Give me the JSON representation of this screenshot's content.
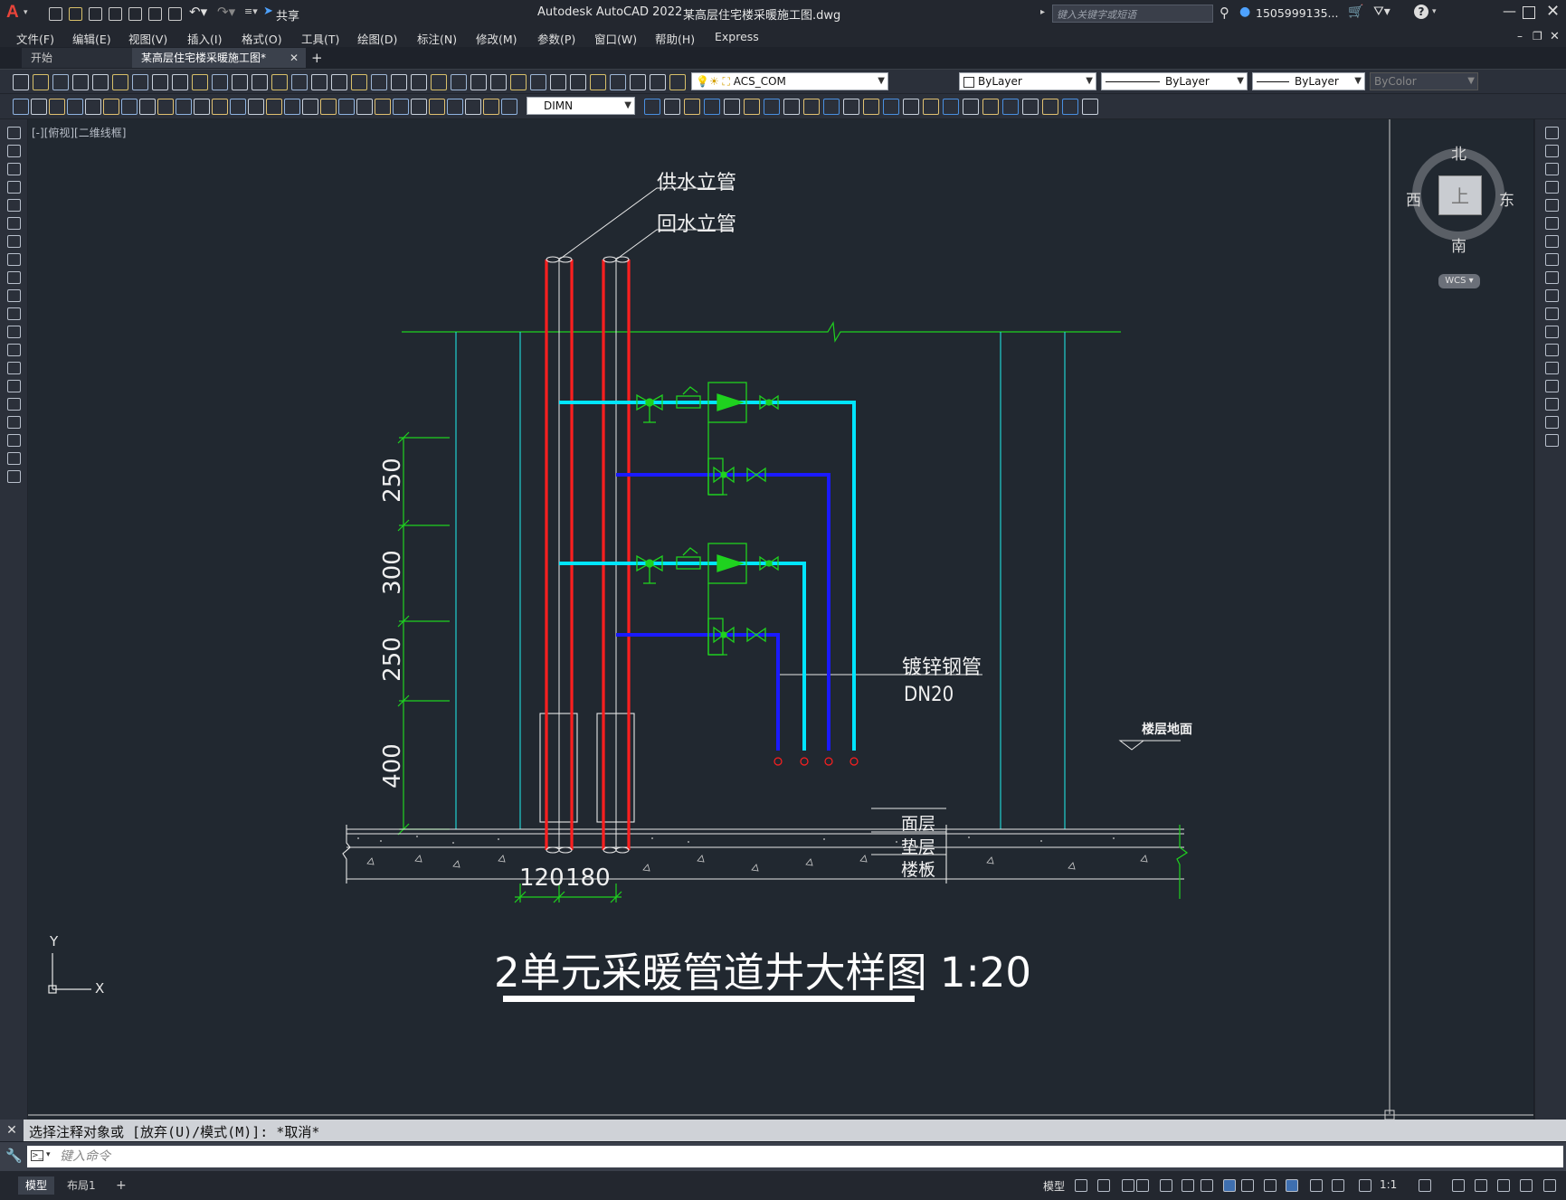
{
  "app": {
    "title": "Autodesk AutoCAD 2022",
    "filename": "某高层住宅楼采暖施工图.dwg",
    "share_label": "共享",
    "search_placeholder": "键入关键字或短语",
    "user": "1505999135..."
  },
  "menu": [
    "文件(F)",
    "编辑(E)",
    "视图(V)",
    "插入(I)",
    "格式(O)",
    "工具(T)",
    "绘图(D)",
    "标注(N)",
    "修改(M)",
    "参数(P)",
    "窗口(W)",
    "帮助(H)",
    "Express"
  ],
  "tabs": {
    "start": "开始",
    "active": "某高层住宅楼采暖施工图*",
    "add": "+"
  },
  "toolbar": {
    "layer": "ACS_COM",
    "color": "ByLayer",
    "linetype": "ByLayer",
    "lineweight": "ByLayer",
    "plotstyle": "ByColor",
    "dimstyle": "DIMN"
  },
  "viewport_label": "[-][俯视][二维线框]",
  "viewcube": {
    "north": "北",
    "south": "南",
    "east": "东",
    "west": "西",
    "face": "上",
    "wcs": "WCS"
  },
  "ucs": {
    "x": "X",
    "y": "Y"
  },
  "drawing": {
    "labels": {
      "supply_riser": "供水立管",
      "return_riser": "回水立管",
      "galv_pipe": "镀锌钢管",
      "dn": "DN20",
      "floor_surface": "楼层地面",
      "surface_layer": "面层",
      "cushion_layer": "垫层",
      "floor_slab": "楼板"
    },
    "dims_vertical": [
      "250",
      "300",
      "250",
      "400"
    ],
    "dims_horizontal": [
      "120",
      "180"
    ],
    "title": "2单元采暖管道井大样图 1:20"
  },
  "command": {
    "history": "选择注释对象或 [放弃(U)/模式(M)]: *取消*",
    "placeholder": "键入命令"
  },
  "layout_tabs": [
    "模型",
    "布局1",
    "+"
  ],
  "status": {
    "model": "模型",
    "scale": "1:1"
  }
}
